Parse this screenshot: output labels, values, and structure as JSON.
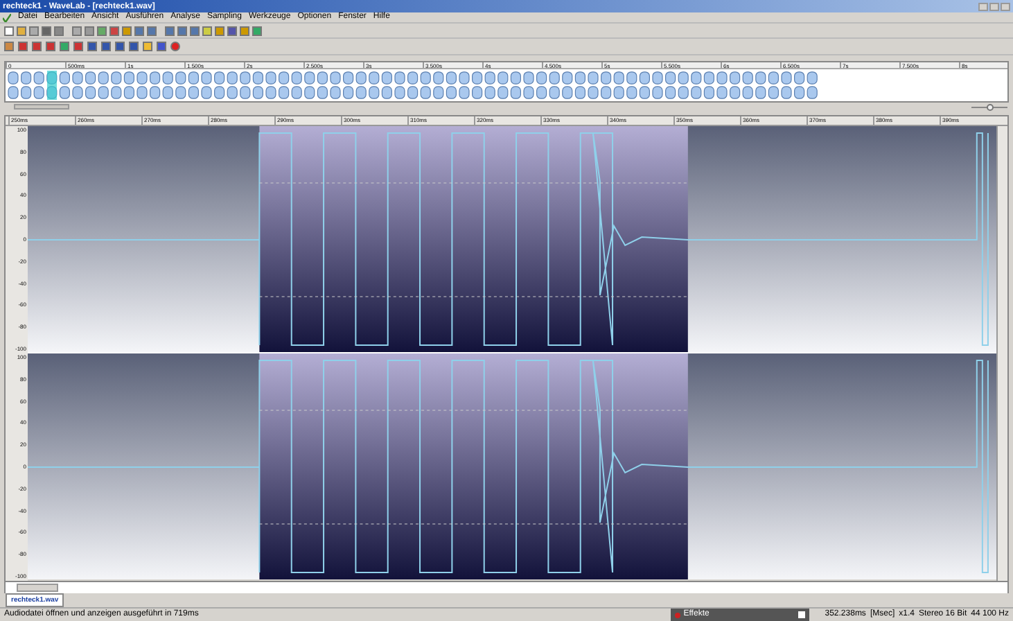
{
  "window": {
    "title": "rechteck1 - WaveLab - [rechteck1.wav]"
  },
  "menu": [
    "Datei",
    "Bearbeiten",
    "Ansicht",
    "Ausführen",
    "Analyse",
    "Sampling",
    "Werkzeuge",
    "Optionen",
    "Fenster",
    "Hilfe"
  ],
  "overview_ruler": [
    "0",
    "500ms",
    "1s",
    "1.500s",
    "2s",
    "2.500s",
    "3s",
    "3.500s",
    "4s",
    "4.500s",
    "5s",
    "5.500s",
    "6s",
    "6.500s",
    "7s",
    "7.500s",
    "8s"
  ],
  "time_ruler": [
    "250ms",
    "260ms",
    "270ms",
    "280ms",
    "290ms",
    "300ms",
    "310ms",
    "320ms",
    "330ms",
    "340ms",
    "350ms",
    "360ms",
    "370ms",
    "380ms",
    "390ms"
  ],
  "zoom_slider": {
    "level": 0.5
  },
  "channels": [
    {
      "amplitude_scale": [
        "100",
        "80",
        "60",
        "40",
        "20",
        "0",
        "-20",
        "-40",
        "-60",
        "-80",
        "-100"
      ]
    },
    {
      "amplitude_scale": [
        "100",
        "80",
        "60",
        "40",
        "20",
        "0",
        "-20",
        "-40",
        "-60",
        "-80",
        "-100"
      ]
    }
  ],
  "document_tabs": [
    {
      "label": "rechteck1.wav",
      "selected": true
    }
  ],
  "status_bar": {
    "message": "Audiodatei öffnen und anzeigen ausgeführt in 719ms",
    "effects_panel": "Effekte",
    "position": "352.238ms",
    "unit": "[Msec]",
    "zoom": "x1.4",
    "format": "Stereo 16 Bit",
    "sample_rate": "44 100 Hz"
  }
}
